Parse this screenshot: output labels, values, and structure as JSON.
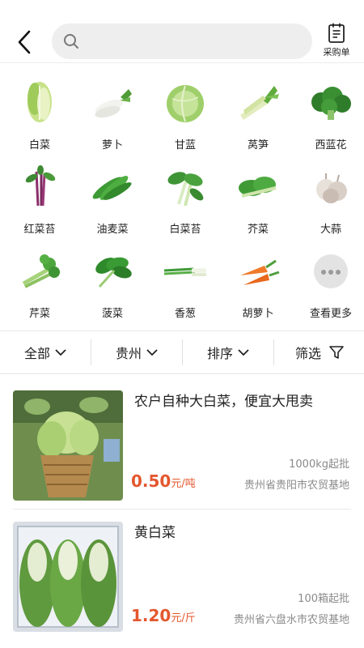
{
  "header": {
    "search_placeholder": "",
    "order_label": "采购单"
  },
  "categories": [
    {
      "label": "白菜",
      "icon": "napa-cabbage"
    },
    {
      "label": "萝卜",
      "icon": "radish"
    },
    {
      "label": "甘蓝",
      "icon": "cabbage"
    },
    {
      "label": "莴笋",
      "icon": "celtuce"
    },
    {
      "label": "西蓝花",
      "icon": "broccoli"
    },
    {
      "label": "红菜苔",
      "icon": "red-choy-sum"
    },
    {
      "label": "油麦菜",
      "icon": "a-choy"
    },
    {
      "label": "白菜苔",
      "icon": "choy-sum"
    },
    {
      "label": "芥菜",
      "icon": "mustard-greens"
    },
    {
      "label": "大蒜",
      "icon": "garlic"
    },
    {
      "label": "芹菜",
      "icon": "celery"
    },
    {
      "label": "菠菜",
      "icon": "spinach"
    },
    {
      "label": "香葱",
      "icon": "scallion"
    },
    {
      "label": "胡萝卜",
      "icon": "carrot"
    },
    {
      "label": "查看更多",
      "icon": "more-dots-icon"
    }
  ],
  "filters": [
    {
      "label": "全部",
      "icon": "chevron-down-icon"
    },
    {
      "label": "贵州",
      "icon": "chevron-down-icon"
    },
    {
      "label": "排序",
      "icon": "chevron-down-icon"
    },
    {
      "label": "筛选",
      "icon": "funnel-icon"
    }
  ],
  "products": [
    {
      "title": "农户自种大白菜，便宜大甩卖",
      "price": "0.50",
      "unit": "元/吨",
      "min_order": "1000kg起批",
      "location": "贵州省贵阳市农贸基地"
    },
    {
      "title": "黄白菜",
      "price": "1.20",
      "unit": "元/斤",
      "min_order": "100箱起批",
      "location": "贵州省六盘水市农贸基地"
    }
  ],
  "colors": {
    "price": "#e4572e",
    "search_bg": "#eeeeee",
    "muted_text": "#8a8a8a"
  }
}
